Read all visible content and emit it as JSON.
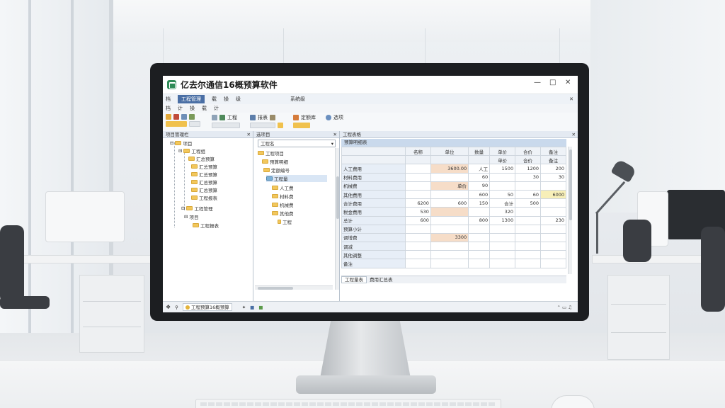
{
  "app": {
    "title": "亿去尔通信16概预算软件",
    "logo_color": "#2e8b57"
  },
  "menu": {
    "row1": [
      "档",
      "载",
      "操",
      "级"
    ],
    "active_tab": "工程管理",
    "row1_right": [
      "系统级"
    ],
    "row2": [
      "档",
      "计",
      "操",
      "载",
      "计"
    ]
  },
  "ribbon": {
    "groups": [
      "工程",
      "报表",
      "定额库",
      "选项"
    ]
  },
  "project_pane": {
    "title": "项目管理栏",
    "items": [
      "项目",
      "工程组",
      "汇总预算",
      "汇总预算",
      "汇总预算",
      "汇总预算",
      "汇总预算",
      "工程报表",
      "工程管理",
      "项目",
      "工程报表"
    ]
  },
  "middle_pane": {
    "title": "选项目",
    "combo_value": "工程名",
    "items": [
      "工程项目",
      "预算明细",
      "定额编号",
      "工程量",
      "人工费",
      "材料费",
      "机械费",
      "其他费",
      "工程"
    ]
  },
  "grid_pane": {
    "title": "工程表格",
    "subtitle": "预算明细表",
    "headers": [
      "名称",
      "单位",
      "数量",
      "单价",
      "合价",
      "备注"
    ],
    "subheaders": [
      "",
      "",
      "",
      "单价",
      "合价",
      "备注"
    ],
    "rows": [
      {
        "name": "人工费用",
        "cells": [
          "",
          "3600.00",
          "人工",
          "1500",
          "1200",
          "200"
        ]
      },
      {
        "name": "材料费用",
        "cells": [
          "",
          "",
          "60",
          "",
          "30",
          "30"
        ]
      },
      {
        "name": "机械费",
        "cells": [
          "",
          "单价",
          "90",
          "",
          "",
          ""
        ]
      },
      {
        "name": "其他费用",
        "cells": [
          "",
          "",
          "600",
          "50",
          "60",
          "6000"
        ]
      },
      {
        "name": "合计费用",
        "cells": [
          "6200",
          "600",
          "150",
          "合计",
          "500",
          ""
        ]
      },
      {
        "name": "税金费用",
        "cells": [
          "530",
          "",
          "",
          "320",
          "",
          ""
        ]
      },
      {
        "name": "总计",
        "cells": [
          "600",
          "",
          "800",
          "1300",
          "",
          "230"
        ]
      },
      {
        "name": "预算小计",
        "cells": [
          "",
          "",
          "",
          "",
          "",
          ""
        ]
      },
      {
        "name": "调增费",
        "cells": [
          "",
          "3300",
          "",
          "",
          "",
          ""
        ]
      },
      {
        "name": "调减",
        "cells": [
          "",
          "",
          "",
          "",
          "",
          ""
        ]
      },
      {
        "name": "其他调整",
        "cells": [
          "",
          "",
          "",
          "",
          "",
          ""
        ]
      },
      {
        "name": "备注",
        "cells": [
          "",
          "",
          "",
          "",
          "",
          ""
        ]
      }
    ],
    "sheet_tabs": [
      "工程量表",
      "费用汇总表"
    ]
  },
  "taskbar": {
    "items": [
      "工程预算16概预算"
    ],
    "tray_time": ""
  }
}
